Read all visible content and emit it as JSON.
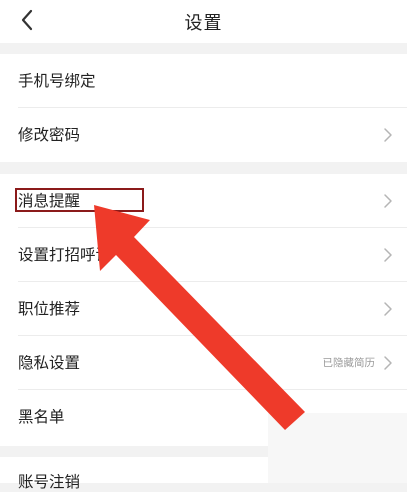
{
  "header": {
    "title": "设置"
  },
  "rows": [
    {
      "label": "手机号绑定"
    },
    {
      "label": "修改密码"
    },
    {
      "label": "消息提醒"
    },
    {
      "label": "设置打招呼语"
    },
    {
      "label": "职位推荐"
    },
    {
      "label": "隐私设置",
      "value": "已隐藏简历"
    },
    {
      "label": "黑名单"
    },
    {
      "label": "账号注销"
    }
  ],
  "colors": {
    "annotation_box": "#8b1a1a",
    "annotation_arrow": "#ee3a2a"
  },
  "icons": {
    "back": "chevron-left-icon",
    "disclosure": "chevron-right-icon"
  }
}
